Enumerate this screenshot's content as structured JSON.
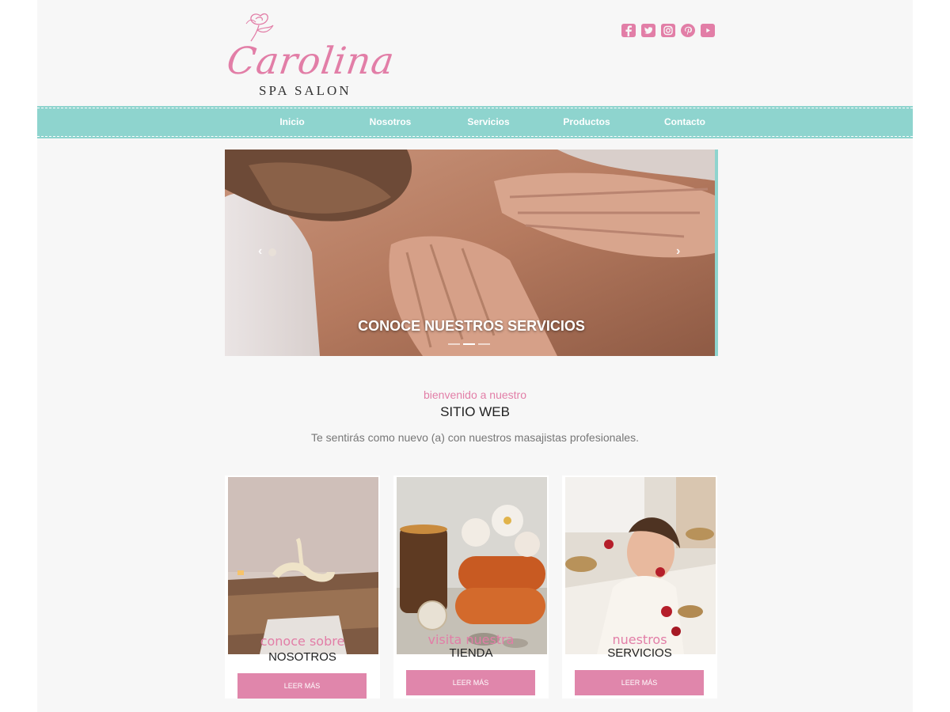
{
  "brand": {
    "name": "Carolina",
    "tagline": "SPA SALON",
    "accent_color": "#e27ea7",
    "nav_color": "#8ed4ce"
  },
  "social": [
    {
      "name": "facebook-icon",
      "glyph": "f"
    },
    {
      "name": "twitter-icon",
      "glyph": "t"
    },
    {
      "name": "instagram-icon",
      "glyph": "◎"
    },
    {
      "name": "pinterest-icon",
      "glyph": "p"
    },
    {
      "name": "youtube-icon",
      "glyph": "▶"
    }
  ],
  "nav": {
    "items": [
      "Inicio",
      "Nosotros",
      "Servicios",
      "Productos",
      "Contacto"
    ]
  },
  "slider": {
    "caption": "CONOCE NUESTROS SERVICIOS",
    "prev": "‹",
    "next": "›",
    "active_slide": 2,
    "slide_count": 3
  },
  "welcome": {
    "kicker": "bienvenido a nuestro",
    "title": "SITIO WEB",
    "text": "Te sentirás como nuevo (a) con nuestros masajistas profesionales."
  },
  "cards": [
    {
      "script": "conoce sobre",
      "title": "NOSOTROS",
      "button": "LEER MÁS"
    },
    {
      "script": "visita nuestra",
      "title": "TIENDA",
      "button": "LEER MÁS"
    },
    {
      "script": "nuestros",
      "title": "SERVICIOS",
      "button": "LEER MÁS"
    }
  ]
}
